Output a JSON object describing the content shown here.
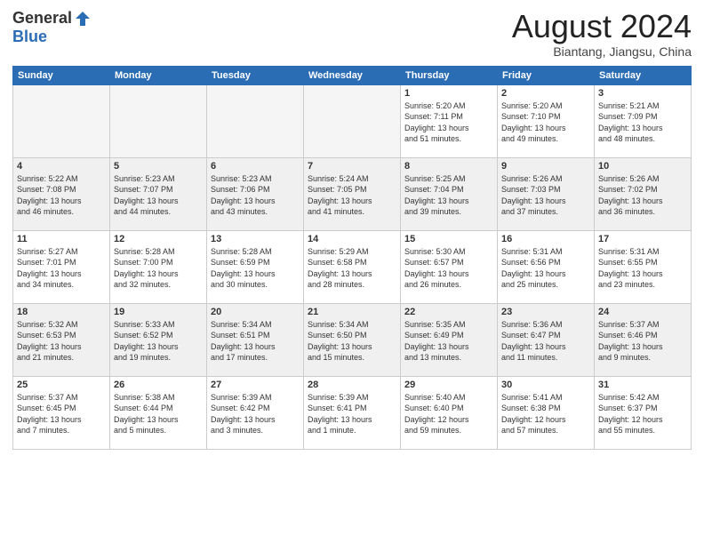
{
  "logo": {
    "general": "General",
    "blue": "Blue"
  },
  "header": {
    "month": "August 2024",
    "location": "Biantang, Jiangsu, China"
  },
  "weekdays": [
    "Sunday",
    "Monday",
    "Tuesday",
    "Wednesday",
    "Thursday",
    "Friday",
    "Saturday"
  ],
  "weeks": [
    [
      {
        "day": "",
        "info": ""
      },
      {
        "day": "",
        "info": ""
      },
      {
        "day": "",
        "info": ""
      },
      {
        "day": "",
        "info": ""
      },
      {
        "day": "1",
        "info": "Sunrise: 5:20 AM\nSunset: 7:11 PM\nDaylight: 13 hours\nand 51 minutes."
      },
      {
        "day": "2",
        "info": "Sunrise: 5:20 AM\nSunset: 7:10 PM\nDaylight: 13 hours\nand 49 minutes."
      },
      {
        "day": "3",
        "info": "Sunrise: 5:21 AM\nSunset: 7:09 PM\nDaylight: 13 hours\nand 48 minutes."
      }
    ],
    [
      {
        "day": "4",
        "info": "Sunrise: 5:22 AM\nSunset: 7:08 PM\nDaylight: 13 hours\nand 46 minutes."
      },
      {
        "day": "5",
        "info": "Sunrise: 5:23 AM\nSunset: 7:07 PM\nDaylight: 13 hours\nand 44 minutes."
      },
      {
        "day": "6",
        "info": "Sunrise: 5:23 AM\nSunset: 7:06 PM\nDaylight: 13 hours\nand 43 minutes."
      },
      {
        "day": "7",
        "info": "Sunrise: 5:24 AM\nSunset: 7:05 PM\nDaylight: 13 hours\nand 41 minutes."
      },
      {
        "day": "8",
        "info": "Sunrise: 5:25 AM\nSunset: 7:04 PM\nDaylight: 13 hours\nand 39 minutes."
      },
      {
        "day": "9",
        "info": "Sunrise: 5:26 AM\nSunset: 7:03 PM\nDaylight: 13 hours\nand 37 minutes."
      },
      {
        "day": "10",
        "info": "Sunrise: 5:26 AM\nSunset: 7:02 PM\nDaylight: 13 hours\nand 36 minutes."
      }
    ],
    [
      {
        "day": "11",
        "info": "Sunrise: 5:27 AM\nSunset: 7:01 PM\nDaylight: 13 hours\nand 34 minutes."
      },
      {
        "day": "12",
        "info": "Sunrise: 5:28 AM\nSunset: 7:00 PM\nDaylight: 13 hours\nand 32 minutes."
      },
      {
        "day": "13",
        "info": "Sunrise: 5:28 AM\nSunset: 6:59 PM\nDaylight: 13 hours\nand 30 minutes."
      },
      {
        "day": "14",
        "info": "Sunrise: 5:29 AM\nSunset: 6:58 PM\nDaylight: 13 hours\nand 28 minutes."
      },
      {
        "day": "15",
        "info": "Sunrise: 5:30 AM\nSunset: 6:57 PM\nDaylight: 13 hours\nand 26 minutes."
      },
      {
        "day": "16",
        "info": "Sunrise: 5:31 AM\nSunset: 6:56 PM\nDaylight: 13 hours\nand 25 minutes."
      },
      {
        "day": "17",
        "info": "Sunrise: 5:31 AM\nSunset: 6:55 PM\nDaylight: 13 hours\nand 23 minutes."
      }
    ],
    [
      {
        "day": "18",
        "info": "Sunrise: 5:32 AM\nSunset: 6:53 PM\nDaylight: 13 hours\nand 21 minutes."
      },
      {
        "day": "19",
        "info": "Sunrise: 5:33 AM\nSunset: 6:52 PM\nDaylight: 13 hours\nand 19 minutes."
      },
      {
        "day": "20",
        "info": "Sunrise: 5:34 AM\nSunset: 6:51 PM\nDaylight: 13 hours\nand 17 minutes."
      },
      {
        "day": "21",
        "info": "Sunrise: 5:34 AM\nSunset: 6:50 PM\nDaylight: 13 hours\nand 15 minutes."
      },
      {
        "day": "22",
        "info": "Sunrise: 5:35 AM\nSunset: 6:49 PM\nDaylight: 13 hours\nand 13 minutes."
      },
      {
        "day": "23",
        "info": "Sunrise: 5:36 AM\nSunset: 6:47 PM\nDaylight: 13 hours\nand 11 minutes."
      },
      {
        "day": "24",
        "info": "Sunrise: 5:37 AM\nSunset: 6:46 PM\nDaylight: 13 hours\nand 9 minutes."
      }
    ],
    [
      {
        "day": "25",
        "info": "Sunrise: 5:37 AM\nSunset: 6:45 PM\nDaylight: 13 hours\nand 7 minutes."
      },
      {
        "day": "26",
        "info": "Sunrise: 5:38 AM\nSunset: 6:44 PM\nDaylight: 13 hours\nand 5 minutes."
      },
      {
        "day": "27",
        "info": "Sunrise: 5:39 AM\nSunset: 6:42 PM\nDaylight: 13 hours\nand 3 minutes."
      },
      {
        "day": "28",
        "info": "Sunrise: 5:39 AM\nSunset: 6:41 PM\nDaylight: 13 hours\nand 1 minute."
      },
      {
        "day": "29",
        "info": "Sunrise: 5:40 AM\nSunset: 6:40 PM\nDaylight: 12 hours\nand 59 minutes."
      },
      {
        "day": "30",
        "info": "Sunrise: 5:41 AM\nSunset: 6:38 PM\nDaylight: 12 hours\nand 57 minutes."
      },
      {
        "day": "31",
        "info": "Sunrise: 5:42 AM\nSunset: 6:37 PM\nDaylight: 12 hours\nand 55 minutes."
      }
    ]
  ]
}
